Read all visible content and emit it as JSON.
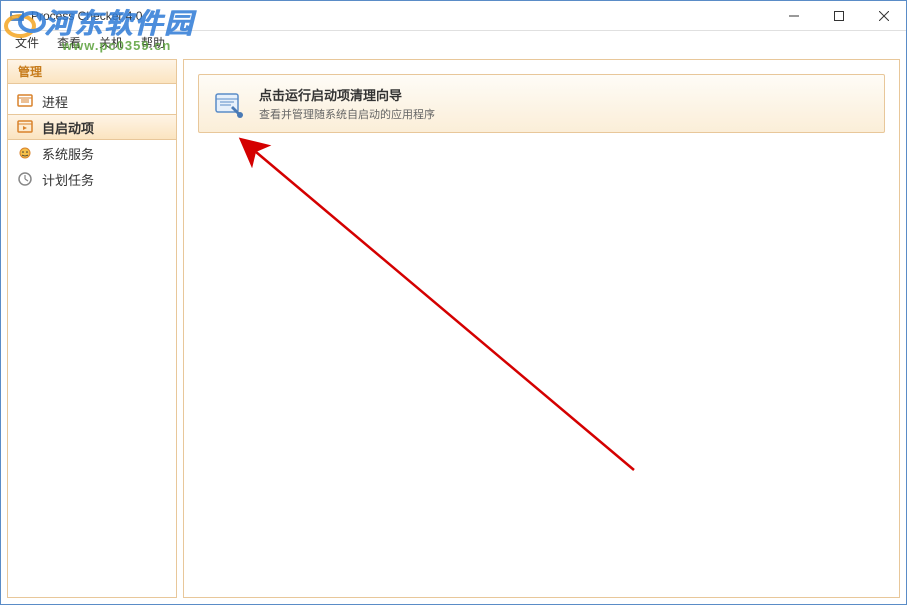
{
  "window": {
    "title": "Process Checker 4.0"
  },
  "menu": {
    "items": [
      "文件",
      "查看",
      "关机",
      "帮助"
    ]
  },
  "sidebar": {
    "header": "管理",
    "items": [
      {
        "label": "进程",
        "icon": "process-icon",
        "active": false
      },
      {
        "label": "自启动项",
        "icon": "startup-icon",
        "active": true
      },
      {
        "label": "系统服务",
        "icon": "services-icon",
        "active": false
      },
      {
        "label": "计划任务",
        "icon": "tasks-icon",
        "active": false
      }
    ]
  },
  "main": {
    "card": {
      "title": "点击运行启动项清理向导",
      "subtitle": "查看并管理随系统自启动的应用程序"
    }
  },
  "watermark": {
    "text": "河东软件园",
    "url": "www.pc0359.cn"
  }
}
